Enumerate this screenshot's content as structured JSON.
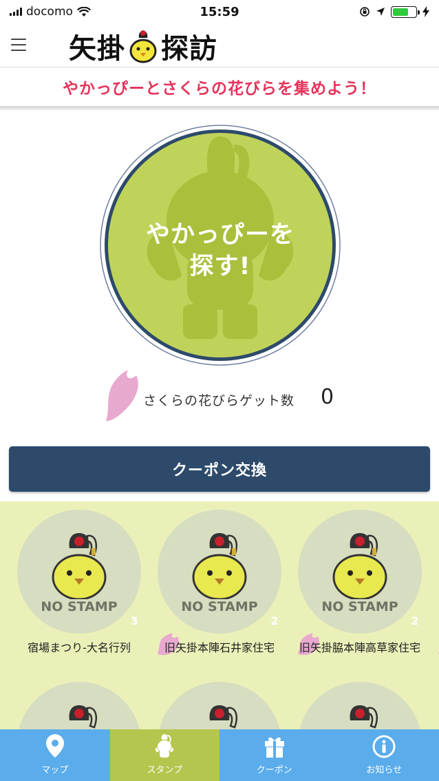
{
  "status_bar": {
    "carrier": "docomo",
    "time": "15:59"
  },
  "header": {
    "logo_text_left": "矢掛",
    "logo_text_right": "探訪"
  },
  "banner": {
    "subtitle": "やかっぴーとさくらの花びらを集めよう！"
  },
  "search": {
    "label_line1": "やかっぴーを",
    "label_line2": "探す!"
  },
  "petals": {
    "label": "さくらの花びらゲット数",
    "count": "0"
  },
  "coupon": {
    "button_label": "クーポン交換"
  },
  "stamps": {
    "items": [
      {
        "status": "NO STAMP",
        "name": "宿場まつり-大名行列",
        "petals": "3"
      },
      {
        "status": "NO STAMP",
        "name": "旧矢掛本陣石井家住宅",
        "petals": "2"
      },
      {
        "status": "NO STAMP",
        "name": "旧矢掛脇本陣高草家住宅",
        "petals": "2"
      }
    ]
  },
  "tabs": [
    {
      "label": "マップ",
      "icon": "map-pin-icon"
    },
    {
      "label": "スタンプ",
      "icon": "chick-icon",
      "active": true
    },
    {
      "label": "クーポン",
      "icon": "gift-icon"
    },
    {
      "label": "お知らせ",
      "icon": "info-icon"
    }
  ],
  "colors": {
    "accent_pink": "#e3345b",
    "navy_button": "#2d4a6b",
    "tab_blue": "#5aaceb",
    "tab_active": "#b6c54e",
    "circle_green": "#bfd35a",
    "stamp_bg": "#eaf0b8",
    "petal_pink": "#e8a9cf"
  }
}
